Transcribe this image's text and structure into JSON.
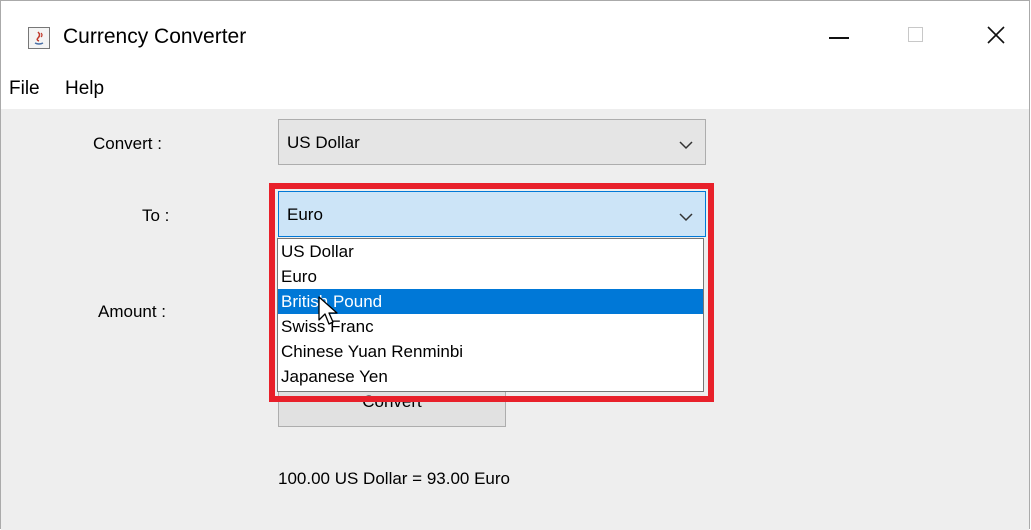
{
  "window": {
    "title": "Currency Converter"
  },
  "menu": {
    "items": [
      "File",
      "Help"
    ]
  },
  "form": {
    "convert_label": "Convert :",
    "convert_value": "US Dollar",
    "to_label": "To :",
    "to_value": "Euro",
    "amount_label": "Amount :",
    "button_label": "Convert",
    "result": "100.00 US Dollar = 93.00 Euro"
  },
  "dropdown": {
    "options": [
      "US Dollar",
      "Euro",
      "British Pound",
      "Swiss Franc",
      "Chinese Yuan Renminbi",
      "Japanese Yen"
    ],
    "selected": "British Pound"
  },
  "colors": {
    "highlight_border": "#e8202a",
    "selection": "#0078d7",
    "focus_fill": "#cce4f7"
  },
  "icons": [
    "java-app-icon",
    "minimize-icon",
    "maximize-icon",
    "close-icon",
    "chevron-down-icon",
    "mouse-cursor-icon"
  ]
}
